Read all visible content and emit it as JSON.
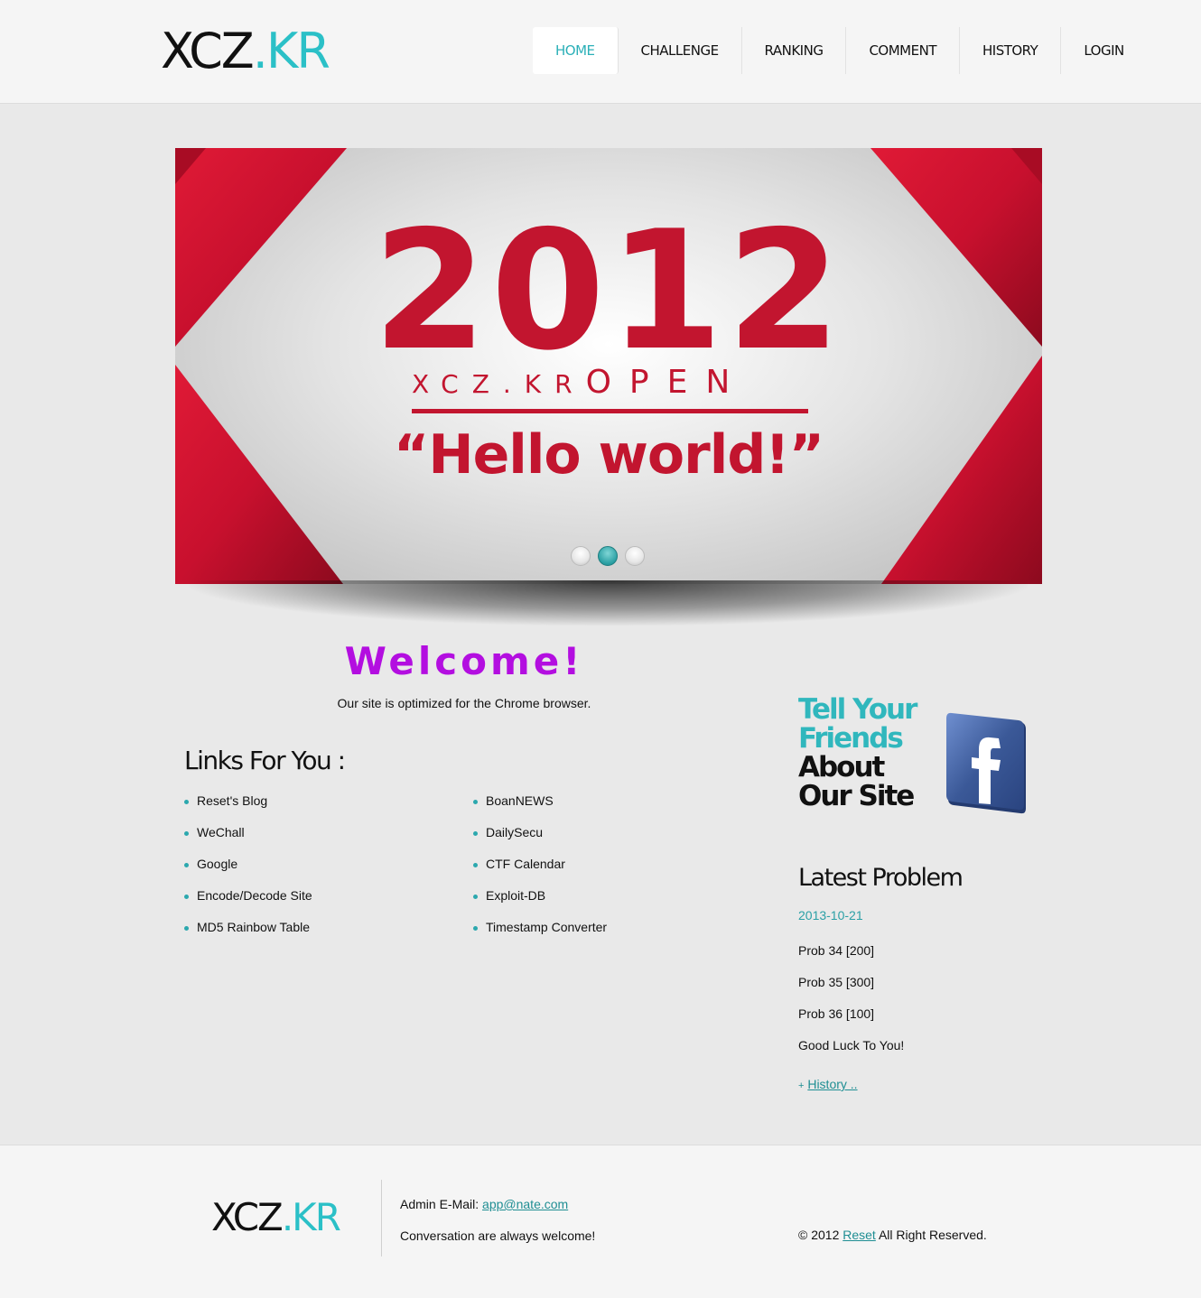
{
  "header": {
    "logo": {
      "main": "XCZ",
      "accent": ".KR"
    },
    "nav": [
      "HOME",
      "CHALLENGE",
      "RANKING",
      "COMMENT",
      "HISTORY",
      "LOGIN"
    ],
    "active_nav": "HOME"
  },
  "slider": {
    "year": "2012",
    "sub_left": "XCZ.KR",
    "sub_right": "OPEN",
    "quote": "“Hello world!”",
    "slide_count": 3,
    "active_slide": 2,
    "colors": {
      "ribbon": "#c8102e",
      "text": "#c2152f",
      "dot_active": "#2a9fa3"
    }
  },
  "welcome": {
    "title": "Welcome!",
    "intro": "Our site is optimized for the Chrome browser."
  },
  "links": {
    "title": "Links For You :",
    "left": [
      "Reset's Blog",
      "WeChall",
      "Google",
      "Encode/Decode Site",
      "MD5 Rainbow Table"
    ],
    "right": [
      "BoanNEWS",
      "DailySecu",
      "CTF Calendar",
      "Exploit-DB",
      "Timestamp Converter"
    ]
  },
  "sidebar": {
    "promo": {
      "line1": "Tell Your",
      "line2": "Friends",
      "line3": "About",
      "line4": "Our Site",
      "icon": "facebook-icon"
    },
    "latest": {
      "title": "Latest Problem",
      "date": "2013-10-21",
      "items": [
        "Prob 34 [200]",
        "Prob 35 [300]",
        "Prob 36 [100]",
        "Good Luck To You!"
      ],
      "history_prefix": "+",
      "history_label": "History .."
    }
  },
  "footer": {
    "logo": {
      "main": "XCZ",
      "accent": ".KR"
    },
    "email_label": "Admin E-Mail:",
    "email": "app@nate.com",
    "note": "Conversation are always welcome!",
    "copy_prefix": "© 2012",
    "copy_link": "Reset",
    "copy_suffix": "All Right Reserved."
  },
  "colors": {
    "accent": "#2bc0c7",
    "welcome": "#b30ee0"
  }
}
